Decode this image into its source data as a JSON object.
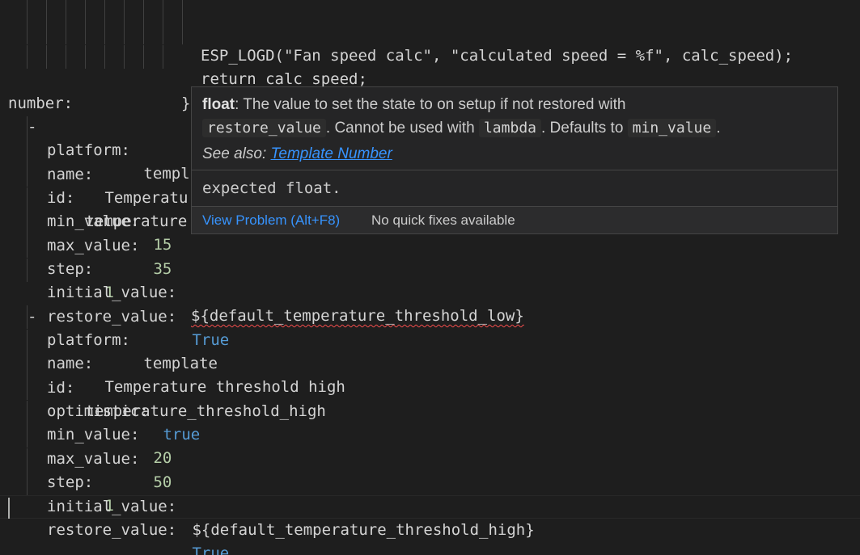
{
  "editor": {
    "lines": {
      "l1": {
        "call": "ESP_LOGD(\"Fan speed calc\", \"calculated speed = %f\", calc_speed);"
      },
      "l2": {
        "ret": "return calc_speed;"
      },
      "l3": {
        "brace": "}"
      },
      "l4": {
        "key": "number:"
      },
      "l5": {
        "dash": "- ",
        "key": "platform:",
        "val": " templ"
      },
      "l6": {
        "key": "name:",
        "val": " Temperatu"
      },
      "l7": {
        "key": "id:",
        "val": " temperature"
      },
      "l8": {
        "key": "min_value:",
        "val": " 15"
      },
      "l9": {
        "key": "max_value:",
        "val": " 35"
      },
      "l10": {
        "key": "step:",
        "val": " 1"
      },
      "l11": {
        "key": "initial_value:",
        "val": "${default_temperature_threshold_low}"
      },
      "l12": {
        "key": "restore_value:",
        "val": " True"
      },
      "l13": {
        "dash": "- ",
        "key": "platform:",
        "val": " template"
      },
      "l14": {
        "key": "name:",
        "val": " Temperature threshold high"
      },
      "l15": {
        "key": "id:",
        "val": " temperature_threshold_high"
      },
      "l16": {
        "key": "optimistic:",
        "val": " true"
      },
      "l17": {
        "key": "min_value:",
        "val": " 20"
      },
      "l18": {
        "key": "max_value:",
        "val": " 50"
      },
      "l19": {
        "key": "step:",
        "val": " 1"
      },
      "l20": {
        "key": "initial_value:",
        "val": " ${default_temperature_threshold_high}"
      },
      "l21": {
        "key": "restore_value:",
        "val": " True"
      }
    }
  },
  "hover": {
    "doc": {
      "term": "float",
      "text1": ": The value to set the state to on setup if not restored with",
      "code_restore": "restore_value",
      "text2": ". Cannot be used with",
      "code_lambda": "lambda",
      "text3": ". Defaults to",
      "code_min": "min_value",
      "text4": ".",
      "see_also": "See also:",
      "link": "Template Number"
    },
    "problem": "expected float.",
    "status": {
      "view_problem": "View Problem (Alt+F8)",
      "no_fixes": "No quick fixes available"
    }
  },
  "colors": {
    "background": "#1e1e1e",
    "number": "#b5cea8",
    "boolean": "#569cd6",
    "link": "#3794ff",
    "error": "#f14c4c"
  }
}
